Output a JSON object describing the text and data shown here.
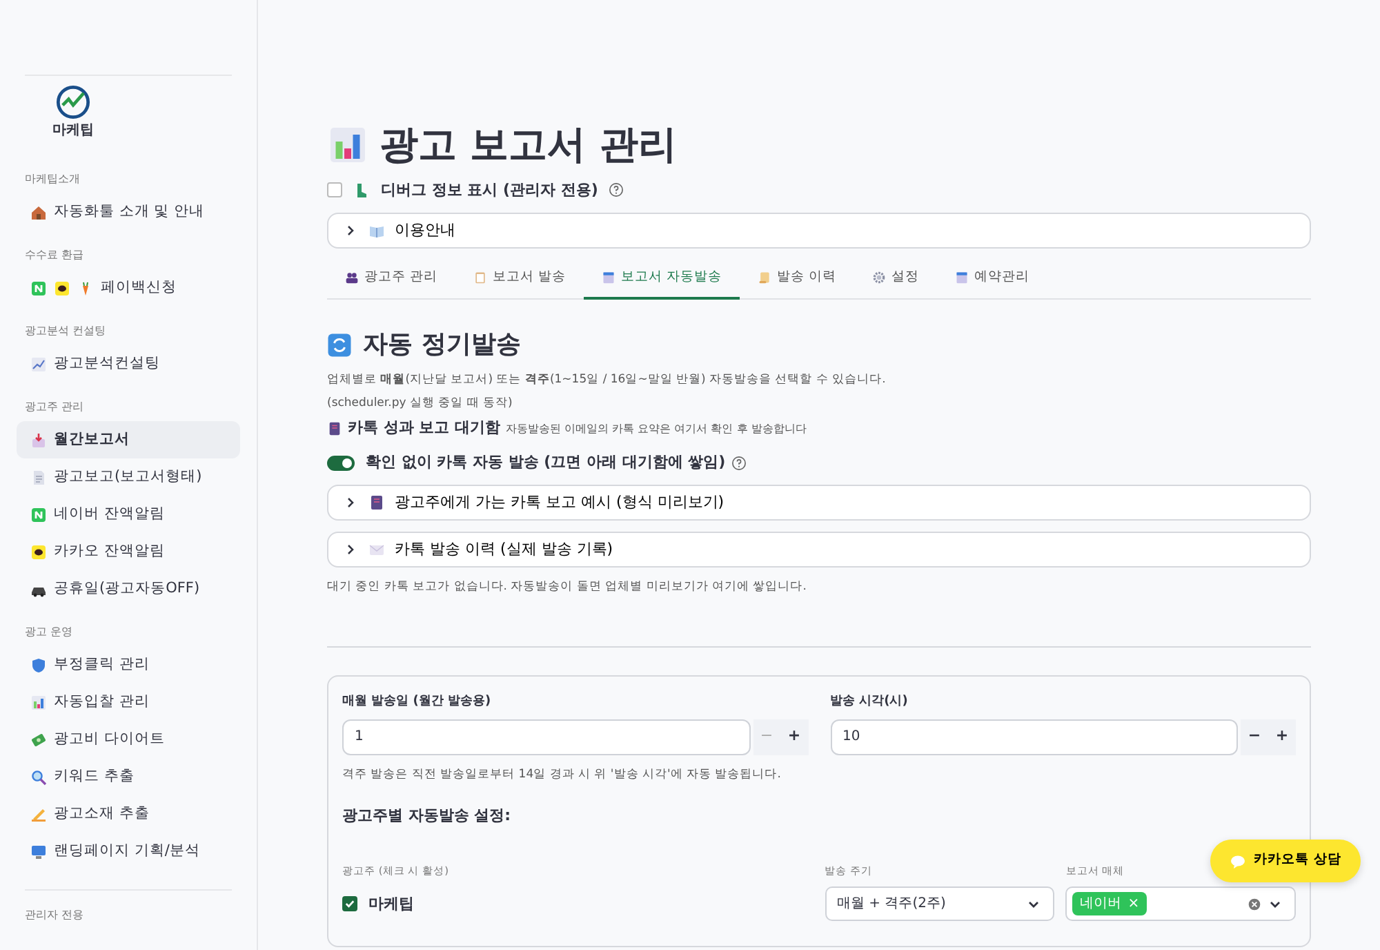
{
  "sidebar": {
    "logo_text": "마케팁",
    "sections": [
      {
        "heading": "마케팁소개",
        "items": [
          {
            "label": "자동화툴 소개 및 안내",
            "selected": false
          }
        ]
      },
      {
        "heading": "수수료 환급",
        "items": [
          {
            "label": "페이백신청",
            "selected": false
          }
        ]
      },
      {
        "heading": "광고분석 컨설팅",
        "items": [
          {
            "label": "광고분석컨설팅",
            "selected": false
          }
        ]
      },
      {
        "heading": "광고주 관리",
        "items": [
          {
            "label": "월간보고서",
            "selected": true
          },
          {
            "label": "광고보고(보고서형태)",
            "selected": false
          },
          {
            "label": "네이버 잔액알림",
            "selected": false
          },
          {
            "label": "카카오 잔액알림",
            "selected": false
          },
          {
            "label": "공휴일(광고자동OFF)",
            "selected": false
          }
        ]
      },
      {
        "heading": "광고 운영",
        "items": [
          {
            "label": "부정클릭 관리",
            "selected": false
          },
          {
            "label": "자동입찰 관리",
            "selected": false
          },
          {
            "label": "광고비 다이어트",
            "selected": false
          },
          {
            "label": "키워드 추출",
            "selected": false
          },
          {
            "label": "광고소재 추출",
            "selected": false
          },
          {
            "label": "랜딩페이지 기획/분석",
            "selected": false
          }
        ]
      },
      {
        "heading": "관리자 전용"
      }
    ]
  },
  "page_title": "광고 보고서 관리",
  "debug_checkbox": {
    "label": "디버그 정보 표시 (관리자 전용)",
    "checked": false
  },
  "guide_expander": {
    "label": "이용안내",
    "expanded": false
  },
  "tabs": [
    {
      "label": "광고주 관리",
      "selected": false
    },
    {
      "label": "보고서 발송",
      "selected": false
    },
    {
      "label": "보고서 자동발송",
      "selected": true
    },
    {
      "label": "발송 이력",
      "selected": false
    },
    {
      "label": "설정",
      "selected": false
    },
    {
      "label": "예약관리",
      "selected": false
    }
  ],
  "section_title": "자동 정기발송",
  "description": "업체별로 **매월**(지난달 보고서) 또는 **격주**(1~15일 / 16일~말일 반월) 자동발송을 선택할 수 있습니다.",
  "note": "(scheduler.py 실행 중일 때 동작)",
  "inbox": {
    "title": "카톡 성과 보고 대기함",
    "caption": "자동발송된 이메일의 카톡 요약은 여기서 확인 후 발송합니다"
  },
  "auto_send_toggle": {
    "label": "확인 없이 카톡 자동 발송 (끄면 아래 대기함에 쌓임)",
    "on": true
  },
  "expanders": [
    {
      "label": "광고주에게 가는 카톡 보고 예시 (형식 미리보기)",
      "expanded": false
    },
    {
      "label": "카톡 발송 이력 (실제 발송 기록)",
      "expanded": false
    }
  ],
  "empty_message": "대기 중인 카톡 보고가 없습니다. 자동발송이 돌면 업체별 미리보기가 여기에 쌓입니다.",
  "settings": {
    "inputs": [
      {
        "label": "매월 발송일 (월간 발송용)",
        "value": "1",
        "minus": "−",
        "plus": "+",
        "minus_disabled": true
      },
      {
        "label": "발송 시각(시)",
        "value": "10",
        "minus": "−",
        "plus": "+",
        "minus_disabled": false
      }
    ],
    "hint": "격주 발송은 직전 발송일로부터 14일 경과 시 위 '발송 시각'에 자동 발송됩니다.",
    "subheading": "광고주별 자동발송 설정:",
    "columns": [
      "광고주 (체크 시 활성)",
      "발송 주기",
      "보고서 매체"
    ],
    "rows": [
      {
        "name": "마케팁",
        "checked": true,
        "cycle": "매월 + 격주(2주)",
        "media": [
          {
            "label": "네이버",
            "remove": "×"
          }
        ]
      }
    ]
  },
  "chat_button": "카카오톡 상담"
}
